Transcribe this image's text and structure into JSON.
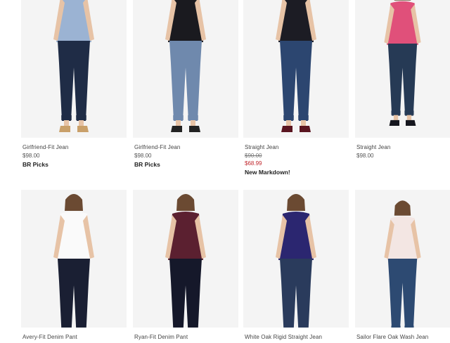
{
  "products": [
    {
      "name": "Girlfriend-Fit Jean",
      "price": "$98.00",
      "tag": "BR Picks",
      "colors": {
        "top": "#9bb3d3",
        "pant": "#1f2c46",
        "shoe": "#c9a06a",
        "skin": "#e7c3a6"
      }
    },
    {
      "name": "Girlfriend-Fit Jean",
      "price": "$98.00",
      "tag": "BR Picks",
      "colors": {
        "top": "#1a1a1f",
        "pant": "#6f89ad",
        "shoe": "#222222",
        "skin": "#e7c3a6"
      }
    },
    {
      "name": "Straight Jean",
      "original_price": "$90.00",
      "sale_price": "$68.99",
      "tag": "New Markdown!",
      "colors": {
        "top": "#1c1c24",
        "pant": "#2c4670",
        "shoe": "#5a1520",
        "skin": "#e7c3a6"
      }
    },
    {
      "name": "Straight Jean",
      "price": "$98.00",
      "colors": {
        "top": "#e0507a",
        "pant": "#263a55",
        "shoe": "#15161e",
        "skin": "#e7c3a6"
      }
    },
    {
      "name": "Avery-Fit Denim Pant",
      "colors": {
        "top": "#fafafa",
        "pant": "#1a1f33",
        "shoe": "#d9c08a",
        "skin": "#e7c3a6"
      }
    },
    {
      "name": "Ryan-Fit Denim Pant",
      "colors": {
        "top": "#5b2030",
        "pant": "#15182a",
        "shoe": "#aaaaaa",
        "skin": "#e7c3a6"
      }
    },
    {
      "name": "White Oak Rigid Straight Jean",
      "colors": {
        "top": "#2b2670",
        "pant": "#2a3b5c",
        "shoe": "#15161e",
        "skin": "#e7c3a6"
      }
    },
    {
      "name": "Sailor Flare Oak Wash Jean",
      "colors": {
        "top": "#f3e6e3",
        "pant": "#2d4a72",
        "shoe": "#15161e",
        "skin": "#e7c3a6"
      }
    }
  ]
}
